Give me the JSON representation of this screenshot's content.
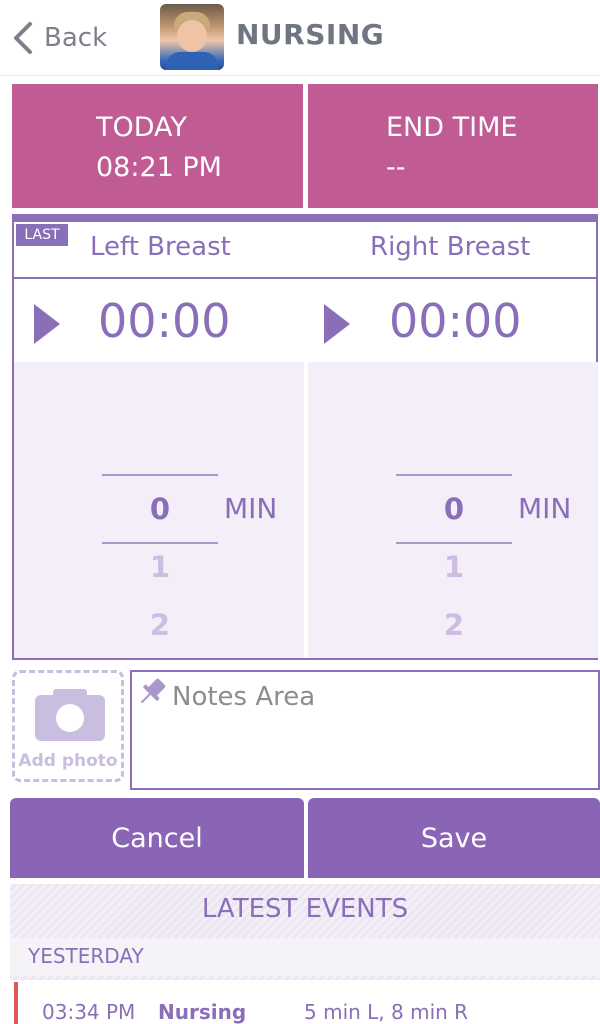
{
  "header": {
    "back_label": "Back",
    "title": "NURSING",
    "icons": {
      "back": "chevron-left-icon",
      "avatar": "child-photo"
    }
  },
  "times": {
    "start": {
      "label": "TODAY",
      "value": "08:21 PM"
    },
    "end": {
      "label": "END TIME",
      "value": "--"
    }
  },
  "timer": {
    "last_badge": "LAST",
    "left": {
      "label": "Left Breast",
      "time": "00:00",
      "picker": {
        "selected": "0",
        "unit": "MIN",
        "next": [
          "1",
          "2"
        ]
      }
    },
    "right": {
      "label": "Right Breast",
      "time": "00:00",
      "picker": {
        "selected": "0",
        "unit": "MIN",
        "next": [
          "1",
          "2"
        ]
      }
    }
  },
  "photo": {
    "label": "Add photo"
  },
  "notes": {
    "placeholder": "Notes Area"
  },
  "buttons": {
    "cancel": "Cancel",
    "save": "Save"
  },
  "latest_events": {
    "title": "LATEST EVENTS",
    "day": "YESTERDAY",
    "rows": [
      {
        "time": "03:34 PM",
        "event": "Nursing",
        "detail": "5 min L, 8 min R"
      }
    ]
  },
  "colors": {
    "accent": "#8a6fb8",
    "magenta": "#c05b94",
    "button": "#8a64b5",
    "marker": "#e05555"
  }
}
